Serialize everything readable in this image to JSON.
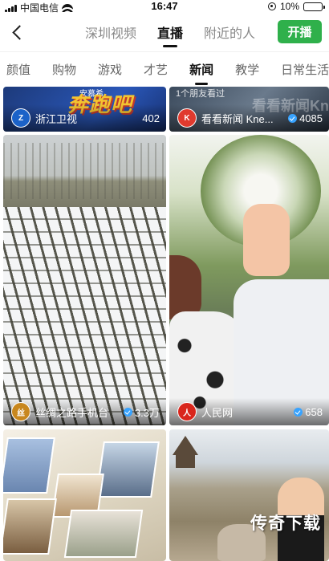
{
  "status_bar": {
    "carrier": "中国电信",
    "time": "16:47",
    "battery": "10%",
    "battery_level": 0.1
  },
  "header": {
    "top_tabs": [
      {
        "label": "深圳视频"
      },
      {
        "label": "直播"
      },
      {
        "label": "附近的人"
      }
    ],
    "active_tab": "直播",
    "live_button": "开播"
  },
  "categories": [
    {
      "label": "颜值"
    },
    {
      "label": "购物"
    },
    {
      "label": "游戏"
    },
    {
      "label": "才艺"
    },
    {
      "label": "新闻"
    },
    {
      "label": "教学"
    },
    {
      "label": "日常生活"
    }
  ],
  "active_category": "新闻",
  "cards": [
    {
      "channel": "浙江卫视",
      "viewers": "402",
      "verified": false,
      "deco_top": "安慕希",
      "deco": "奔跑吧"
    },
    {
      "channel": "看看新闻 Kne...",
      "viewers": "4085",
      "verified": true,
      "friends_tag": "1个朋友看过",
      "deco": "看看新闻Kn"
    },
    {
      "channel": "丝绸之路手机台",
      "viewers": "3.3万",
      "verified": true
    },
    {
      "channel": "人民网",
      "viewers": "658",
      "verified": true
    },
    {
      "channel": "",
      "viewers": "",
      "verified": false
    },
    {
      "channel": "",
      "viewers": "",
      "verified": false
    }
  ],
  "watermark": "传奇下载",
  "colors": {
    "accent_green": "#2fb04b",
    "verified_blue": "#38a3ff"
  }
}
